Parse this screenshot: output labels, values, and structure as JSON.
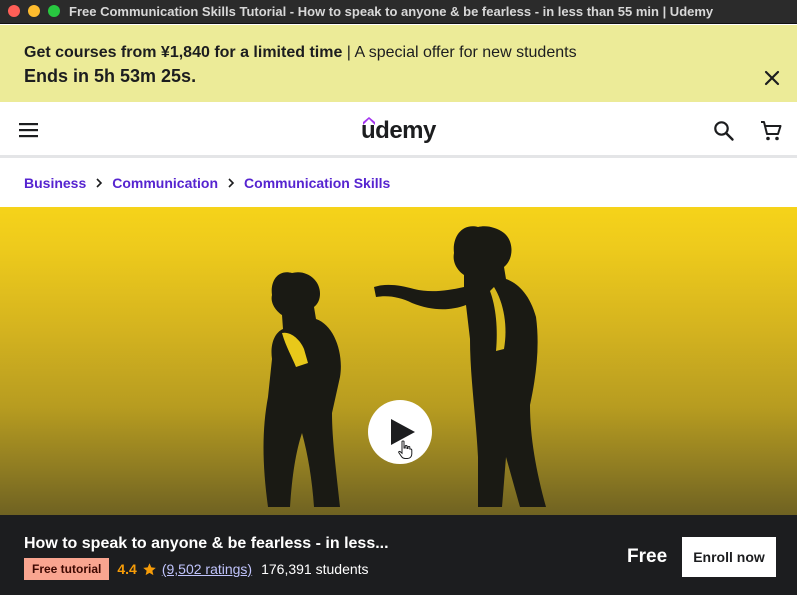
{
  "window": {
    "title": "Free Communication Skills Tutorial - How to speak to anyone & be fearless - in less than 55 min | Udemy"
  },
  "banner": {
    "offer_strong": "Get courses from ¥1,840 for a limited time",
    "offer_rest": " | A special offer for new students",
    "countdown": "Ends in 5h 53m 25s."
  },
  "header": {
    "logo": "udemy"
  },
  "breadcrumb": {
    "items": [
      "Business",
      "Communication",
      "Communication Skills"
    ]
  },
  "course": {
    "title": "How to speak to anyone & be fearless - in less...",
    "badge": "Free tutorial",
    "rating": "4.4",
    "ratings_count": "(9,502 ratings)",
    "students": "176,391 students",
    "price": "Free",
    "enroll_label": "Enroll now"
  },
  "colors": {
    "banner_bg": "#eceb98",
    "link_purple": "#5624d0",
    "rating_orange": "#f69c08",
    "badge_bg": "#f9a590",
    "bar_bg": "#1c1d1f"
  },
  "icons": {
    "banner_close": "close-icon",
    "menu": "hamburger-menu-icon",
    "search": "search-icon",
    "cart": "cart-icon",
    "breadcrumb_sep": "chevron-right-icon",
    "play": "play-icon",
    "star": "star-icon"
  }
}
